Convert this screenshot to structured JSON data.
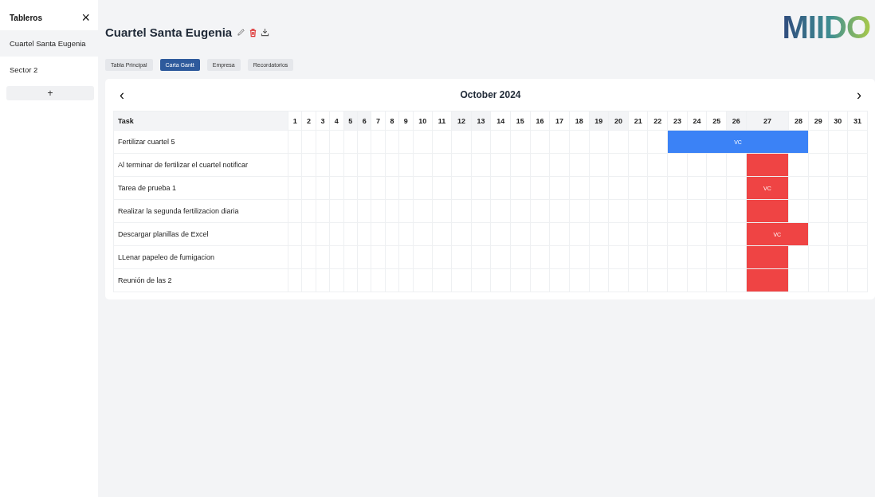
{
  "sidebar": {
    "title": "Tableros",
    "close": "×",
    "items": [
      {
        "label": "Cuartel Santa Eugenia",
        "selected": true
      },
      {
        "label": "Sector 2",
        "selected": false
      }
    ],
    "add": "+"
  },
  "header": {
    "title": "Cuartel Santa Eugenia",
    "logo": "MIIDO"
  },
  "tabs": [
    {
      "label": "Tabla Principal",
      "selected": false
    },
    {
      "label": "Carta Gantt",
      "selected": true
    },
    {
      "label": "Empresa",
      "selected": false
    },
    {
      "label": "Recordatorios",
      "selected": false
    }
  ],
  "gantt": {
    "month": "October 2024",
    "prev": "‹",
    "next": "›",
    "task_header": "Task",
    "days": [
      {
        "label": "1",
        "weekend": false
      },
      {
        "label": "2",
        "weekend": false
      },
      {
        "label": "3",
        "weekend": false
      },
      {
        "label": "4",
        "weekend": false
      },
      {
        "label": "5",
        "weekend": true
      },
      {
        "label": "6",
        "weekend": true
      },
      {
        "label": "7",
        "weekend": false
      },
      {
        "label": "8",
        "weekend": false
      },
      {
        "label": "9",
        "weekend": false
      },
      {
        "label": "10",
        "weekend": false
      },
      {
        "label": "11",
        "weekend": false
      },
      {
        "label": "12",
        "weekend": true
      },
      {
        "label": "13",
        "weekend": true
      },
      {
        "label": "14",
        "weekend": false
      },
      {
        "label": "15",
        "weekend": false
      },
      {
        "label": "16",
        "weekend": false
      },
      {
        "label": "17",
        "weekend": false
      },
      {
        "label": "18",
        "weekend": false
      },
      {
        "label": "19",
        "weekend": true
      },
      {
        "label": "20",
        "weekend": true
      },
      {
        "label": "21",
        "weekend": false
      },
      {
        "label": "22",
        "weekend": false
      },
      {
        "label": "23",
        "weekend": false
      },
      {
        "label": "24",
        "weekend": false
      },
      {
        "label": "25",
        "weekend": false
      },
      {
        "label": "26",
        "weekend": true
      },
      {
        "label": "27",
        "weekend": true
      },
      {
        "label": "28",
        "weekend": false
      },
      {
        "label": "29",
        "weekend": false
      },
      {
        "label": "30",
        "weekend": false
      },
      {
        "label": "31",
        "weekend": false
      }
    ],
    "tasks": [
      {
        "name": "Fertilizar cuartel 5",
        "color": "#3b82f6",
        "bar_label": "VC",
        "active": [
          false,
          false,
          false,
          false,
          false,
          false,
          false,
          false,
          false,
          false,
          false,
          false,
          false,
          false,
          false,
          false,
          false,
          false,
          false,
          false,
          false,
          false,
          true,
          true,
          true,
          true,
          true,
          true,
          false,
          false,
          false
        ]
      },
      {
        "name": "Al terminar de fertilizar el cuartel notificar",
        "color": "#ef4444",
        "active": [
          false,
          false,
          false,
          false,
          false,
          false,
          false,
          false,
          false,
          false,
          false,
          false,
          false,
          false,
          false,
          false,
          false,
          false,
          false,
          false,
          false,
          false,
          false,
          false,
          false,
          false,
          true,
          false,
          false,
          false,
          false
        ]
      },
      {
        "name": "Tarea de prueba 1",
        "color": "#ef4444",
        "bar_label": "VC",
        "active": [
          false,
          false,
          false,
          false,
          false,
          false,
          false,
          false,
          false,
          false,
          false,
          false,
          false,
          false,
          false,
          false,
          false,
          false,
          false,
          false,
          false,
          false,
          false,
          false,
          false,
          false,
          true,
          false,
          false,
          false,
          false
        ]
      },
      {
        "name": "Realizar la segunda fertilizacion diaria",
        "color": "#ef4444",
        "active": [
          false,
          false,
          false,
          false,
          false,
          false,
          false,
          false,
          false,
          false,
          false,
          false,
          false,
          false,
          false,
          false,
          false,
          false,
          false,
          false,
          false,
          false,
          false,
          false,
          false,
          false,
          true,
          false,
          false,
          false,
          false
        ]
      },
      {
        "name": "Descargar planillas de Excel",
        "color": "#ef4444",
        "bar_label": "VC",
        "active": [
          false,
          false,
          false,
          false,
          false,
          false,
          false,
          false,
          false,
          false,
          false,
          false,
          false,
          false,
          false,
          false,
          false,
          false,
          false,
          false,
          false,
          false,
          false,
          false,
          false,
          false,
          true,
          true,
          false,
          false,
          false
        ]
      },
      {
        "name": "LLenar papeleo de fumigacion",
        "color": "#ef4444",
        "active": [
          false,
          false,
          false,
          false,
          false,
          false,
          false,
          false,
          false,
          false,
          false,
          false,
          false,
          false,
          false,
          false,
          false,
          false,
          false,
          false,
          false,
          false,
          false,
          false,
          false,
          false,
          true,
          false,
          false,
          false,
          false
        ]
      },
      {
        "name": "Reunión de las 2",
        "color": "#ef4444",
        "active": [
          false,
          false,
          false,
          false,
          false,
          false,
          false,
          false,
          false,
          false,
          false,
          false,
          false,
          false,
          false,
          false,
          false,
          false,
          false,
          false,
          false,
          false,
          false,
          false,
          false,
          false,
          true,
          false,
          false,
          false,
          false
        ]
      }
    ]
  }
}
